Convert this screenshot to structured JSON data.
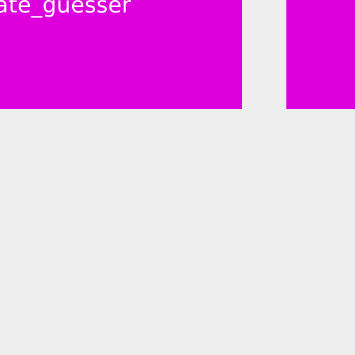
{
  "tiles": [
    {
      "label": "date_guesser",
      "color": "#dd00dd"
    },
    {
      "label": "",
      "color": "#dd00dd"
    }
  ],
  "background_color": "#eeeeee",
  "text_color": "#ffffff"
}
